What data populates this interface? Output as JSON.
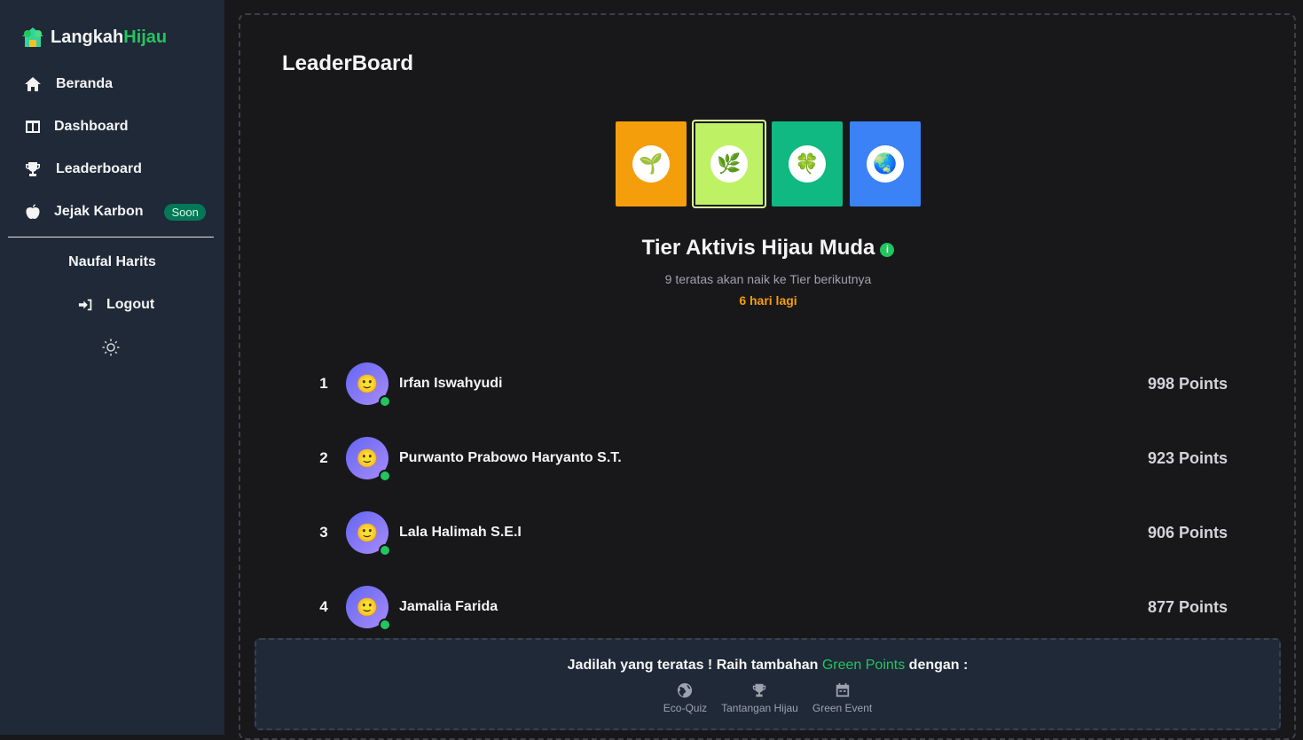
{
  "brand": {
    "part1": "Langkah",
    "part2": "Hijau",
    "logo_icon": "house-leaf-icon"
  },
  "sidebar": {
    "items": [
      {
        "label": "Beranda",
        "icon": "home-icon"
      },
      {
        "label": "Dashboard",
        "icon": "layout-icon"
      },
      {
        "label": "Leaderboard",
        "icon": "trophy-icon"
      },
      {
        "label": "Jejak Karbon",
        "icon": "apple-icon",
        "badge": "Soon"
      }
    ],
    "user_name": "Naufal Harits",
    "logout_label": "Logout",
    "theme_icon": "sun-icon"
  },
  "main": {
    "title": "LeaderBoard",
    "tiers": [
      {
        "icon": "seedling-icon",
        "glyph": "🌱",
        "color": "#f59e0b"
      },
      {
        "icon": "herb-icon",
        "glyph": "🌿",
        "color": "#bef264",
        "active": true
      },
      {
        "icon": "clover-icon",
        "glyph": "🍀",
        "color": "#10b981"
      },
      {
        "icon": "globe-icon",
        "glyph": "🌏",
        "color": "#3b82f6"
      }
    ],
    "tier_title": "Tier Aktivis Hijau Muda",
    "tier_info_icon": "info-icon",
    "tier_subtitle": "9 teratas akan naik ke Tier berikutnya",
    "tier_countdown": "6 hari lagi",
    "leaderboard": [
      {
        "rank": "1",
        "name": "Irfan Iswahyudi",
        "points": "998 Points"
      },
      {
        "rank": "2",
        "name": "Purwanto Prabowo Haryanto S.T.",
        "points": "923 Points"
      },
      {
        "rank": "3",
        "name": "Lala Halimah S.E.I",
        "points": "906 Points"
      },
      {
        "rank": "4",
        "name": "Jamalia Farida",
        "points": "877 Points"
      }
    ]
  },
  "footer": {
    "text_before": "Jadilah yang teratas ! Raih tambahan ",
    "highlight": "Green Points",
    "text_after": " dengan :",
    "links": [
      {
        "label": "Eco-Quiz",
        "icon": "globe-icon"
      },
      {
        "label": "Tantangan Hijau",
        "icon": "trophy-icon"
      },
      {
        "label": "Green Event",
        "icon": "calendar-icon"
      }
    ]
  },
  "colors": {
    "accent": "#22c55e",
    "countdown": "#f59e0b",
    "sidebar_bg": "#1f2937",
    "page_bg": "#18181b"
  }
}
